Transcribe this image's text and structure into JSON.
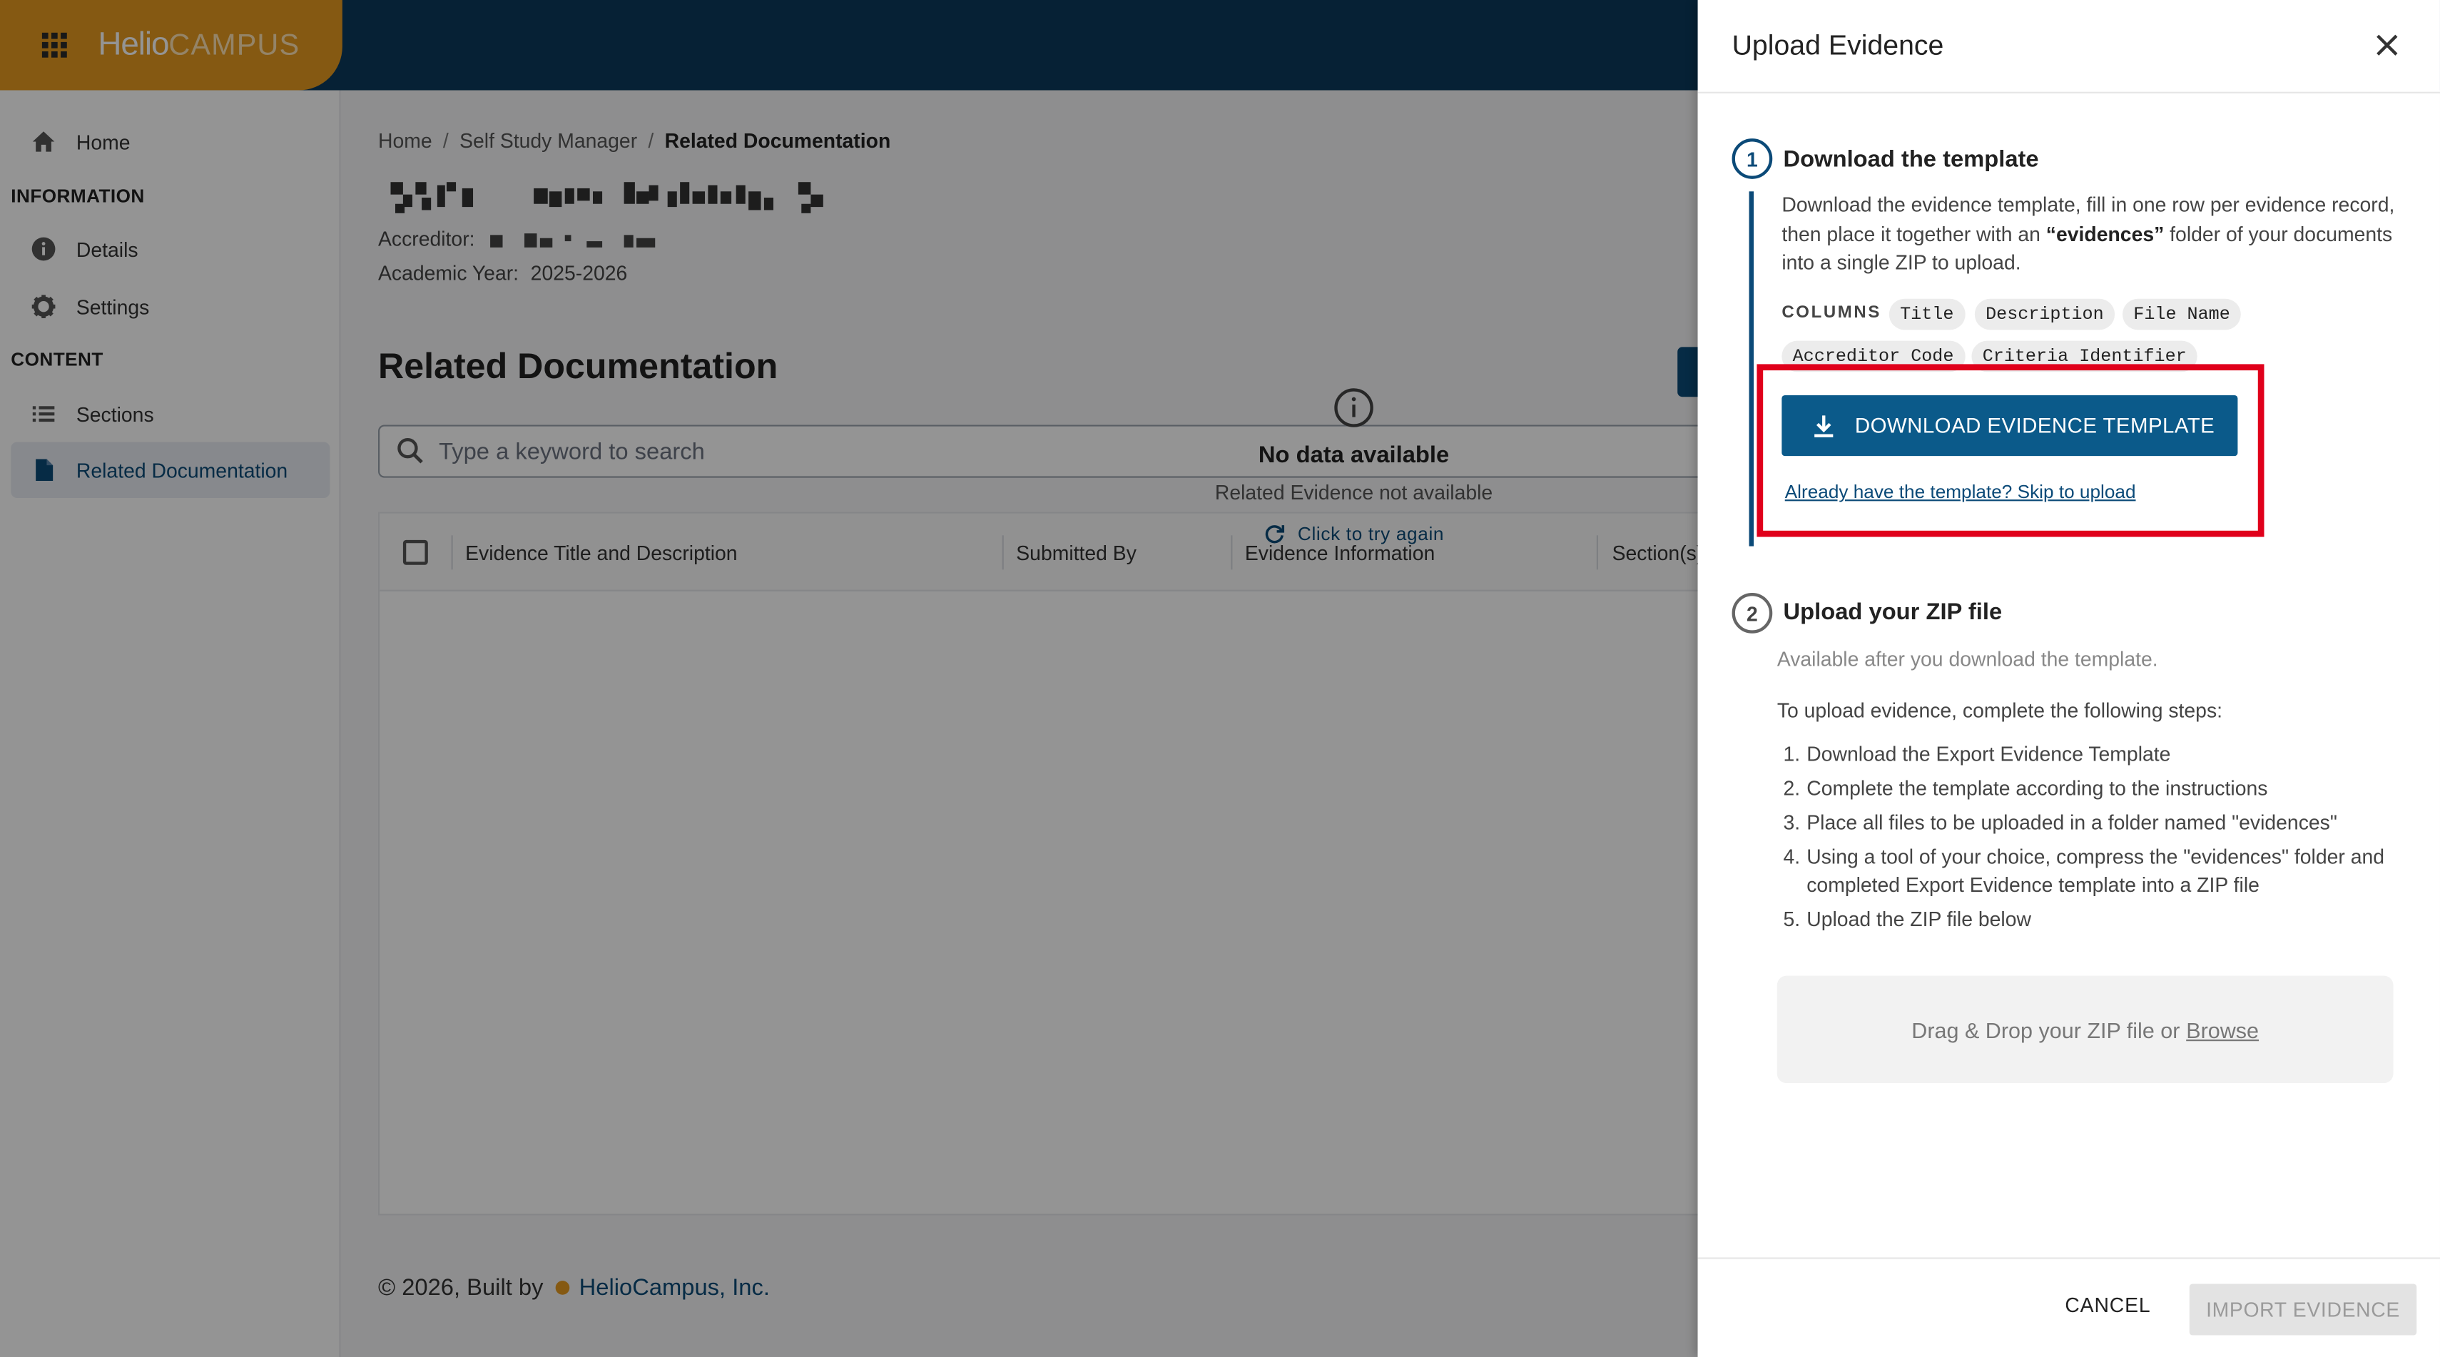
{
  "brand": {
    "name_part1": "Helio",
    "name_part2": "CAMPUS"
  },
  "sidebar": {
    "home": "Home",
    "information_header": "INFORMATION",
    "details": "Details",
    "settings": "Settings",
    "content_header": "CONTENT",
    "sections": "Sections",
    "related_documentation": "Related Documentation"
  },
  "breadcrumb": {
    "items": [
      "Home",
      "Self Study Manager",
      "Related Documentation"
    ]
  },
  "page": {
    "accreditor_label": "Accreditor:",
    "academic_year_label": "Academic Year:",
    "academic_year_value": "2025-2026",
    "section_title": "Related Documentation"
  },
  "search": {
    "placeholder": "Type a keyword to search"
  },
  "table": {
    "columns": [
      "Evidence Title and Description",
      "Submitted By",
      "Evidence Information",
      "Section(s)"
    ]
  },
  "empty_state": {
    "title": "No data available",
    "subtitle": "Related Evidence not available",
    "retry": "Click to try again"
  },
  "footer": {
    "prefix": "© 2026, Built by",
    "link": "HelioCampus, Inc."
  },
  "drawer": {
    "title": "Upload Evidence",
    "step1": {
      "number": "1",
      "title": "Download the template",
      "desc_part1": "Download the evidence template, fill in one row per evidence record, then place it together with an ",
      "desc_bold": "“evidences”",
      "desc_part2": " folder of your documents into a single ZIP to upload.",
      "columns_label": "COLUMNS",
      "columns": [
        "Title",
        "Description",
        "File Name",
        "Accreditor Code",
        "Criteria Identifier"
      ],
      "download_button": "DOWNLOAD EVIDENCE TEMPLATE",
      "skip_link": "Already have the template? Skip to upload"
    },
    "step2": {
      "number": "2",
      "title": "Upload your ZIP file",
      "availability": "Available after you download the template.",
      "instructions_intro": "To upload evidence, complete the following steps:",
      "instructions": [
        "Download the Export Evidence Template",
        "Complete the template according to the instructions",
        "Place all files to be uploaded in a folder named \"evidences\"",
        "Using a tool of your choice, compress the \"evidences\" folder and completed Export Evidence template into a ZIP file",
        "Upload the ZIP file below"
      ],
      "dropzone_text": "Drag & Drop your ZIP file or",
      "dropzone_browse": "Browse"
    },
    "cancel_button": "CANCEL",
    "import_button": "IMPORT EVIDENCE"
  },
  "colors": {
    "primary": "#0b4a78",
    "brand_orange": "#e59a1f",
    "highlight_red": "#e0001b"
  }
}
